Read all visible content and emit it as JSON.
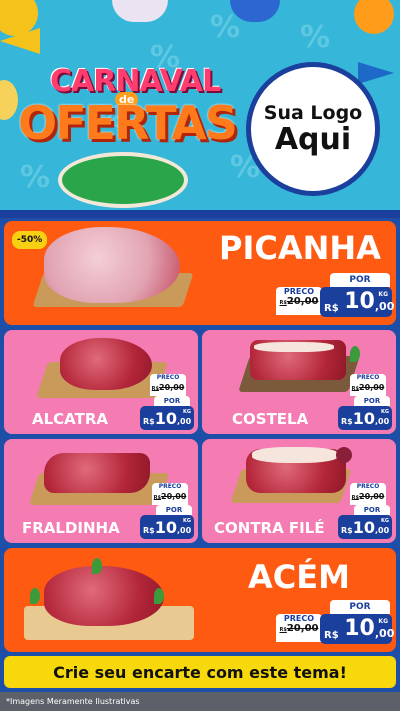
{
  "hero": {
    "title_line1": "CARNAVAL",
    "title_badge": "de",
    "title_line2": "OFERTAS",
    "logo_line1": "Sua Logo",
    "logo_line2": "Aqui",
    "pattern_glyph": "%"
  },
  "currency": "R$",
  "preco_label": "PRECO",
  "por_label": "POR",
  "unit": "KG",
  "products": [
    {
      "name": "PICANHA",
      "badge": "-50%",
      "old_price_prefix": "R$",
      "old_price": "20",
      "old_cents": ",00",
      "price": "10",
      "cents": ",00"
    },
    {
      "name": "ALCATRA",
      "old_price_prefix": "R$",
      "old_price": "20",
      "old_cents": ",00",
      "price": "10",
      "cents": ",00"
    },
    {
      "name": "COSTELA",
      "old_price_prefix": "R$",
      "old_price": "20",
      "old_cents": ",00",
      "price": "10",
      "cents": ",00"
    },
    {
      "name": "FRALDINHA",
      "old_price_prefix": "R$",
      "old_price": "20",
      "old_cents": ",00",
      "price": "10",
      "cents": ",00"
    },
    {
      "name": "CONTRA FILÉ",
      "old_price_prefix": "R$",
      "old_price": "20",
      "old_cents": ",00",
      "price": "10",
      "cents": ",00"
    },
    {
      "name": "ACÉM",
      "old_price_prefix": "R$",
      "old_price": "20",
      "old_cents": ",00",
      "price": "10",
      "cents": ",00"
    }
  ],
  "cta": "Crie seu encarte com este tema!",
  "footer": "*Imagens Meramente Ilustrativas",
  "colors": {
    "orange": "#ff5a12",
    "pink": "#f47cb3",
    "navy": "#1b3f9c",
    "yellow": "#f7d80b",
    "sky": "#36b6d8"
  }
}
